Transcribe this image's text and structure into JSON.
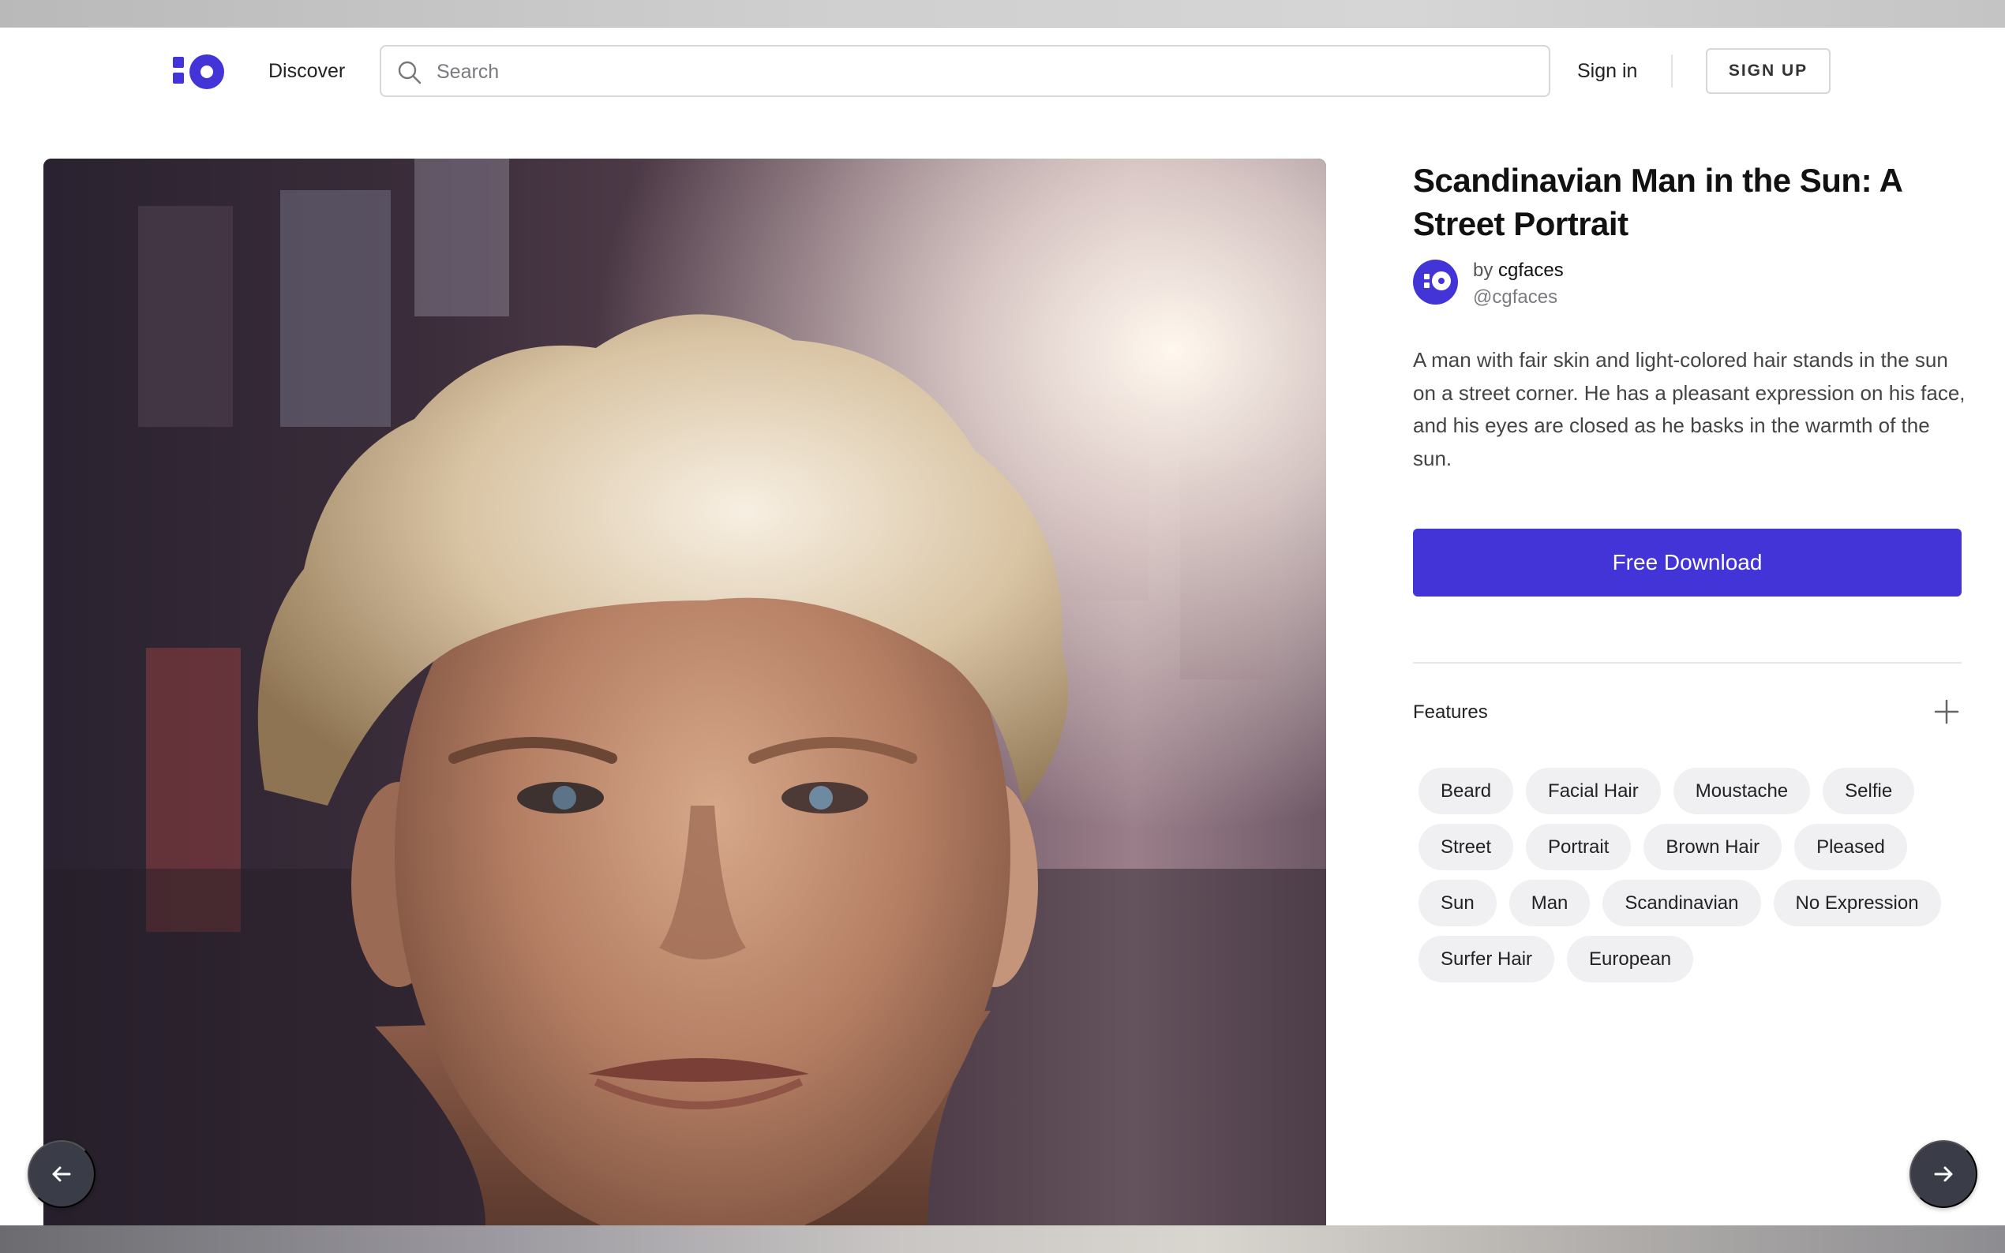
{
  "header": {
    "discover_label": "Discover",
    "search_placeholder": "Search",
    "signin_label": "Sign in",
    "signup_label": "SIGN UP"
  },
  "photo": {
    "icon": "portrait-photo"
  },
  "detail": {
    "title": "Scandinavian Man in the Sun: A Street Portrait",
    "author": {
      "by_prefix": "by",
      "name": "cgfaces",
      "handle": "@cgfaces"
    },
    "description": "A man with fair skin and light-colored hair stands in the sun on a street corner. He has a pleasant expression on his face, and his eyes are closed as he basks in the warmth of the sun.",
    "download_label": "Free Download",
    "features_label": "Features",
    "tag_rows": [
      [
        "Beard",
        "Facial Hair",
        "Moustache",
        "Selfie"
      ],
      [
        "Street",
        "Portrait",
        "Brown Hair",
        "Pleased"
      ],
      [
        "Sun",
        "Man",
        "Scandinavian",
        "No Expression"
      ],
      [
        "Surfer Hair",
        "European"
      ]
    ]
  },
  "colors": {
    "accent": "#4334d8",
    "tag_bg": "#f0f0f2",
    "nav_button_bg": "#3a3d48"
  }
}
